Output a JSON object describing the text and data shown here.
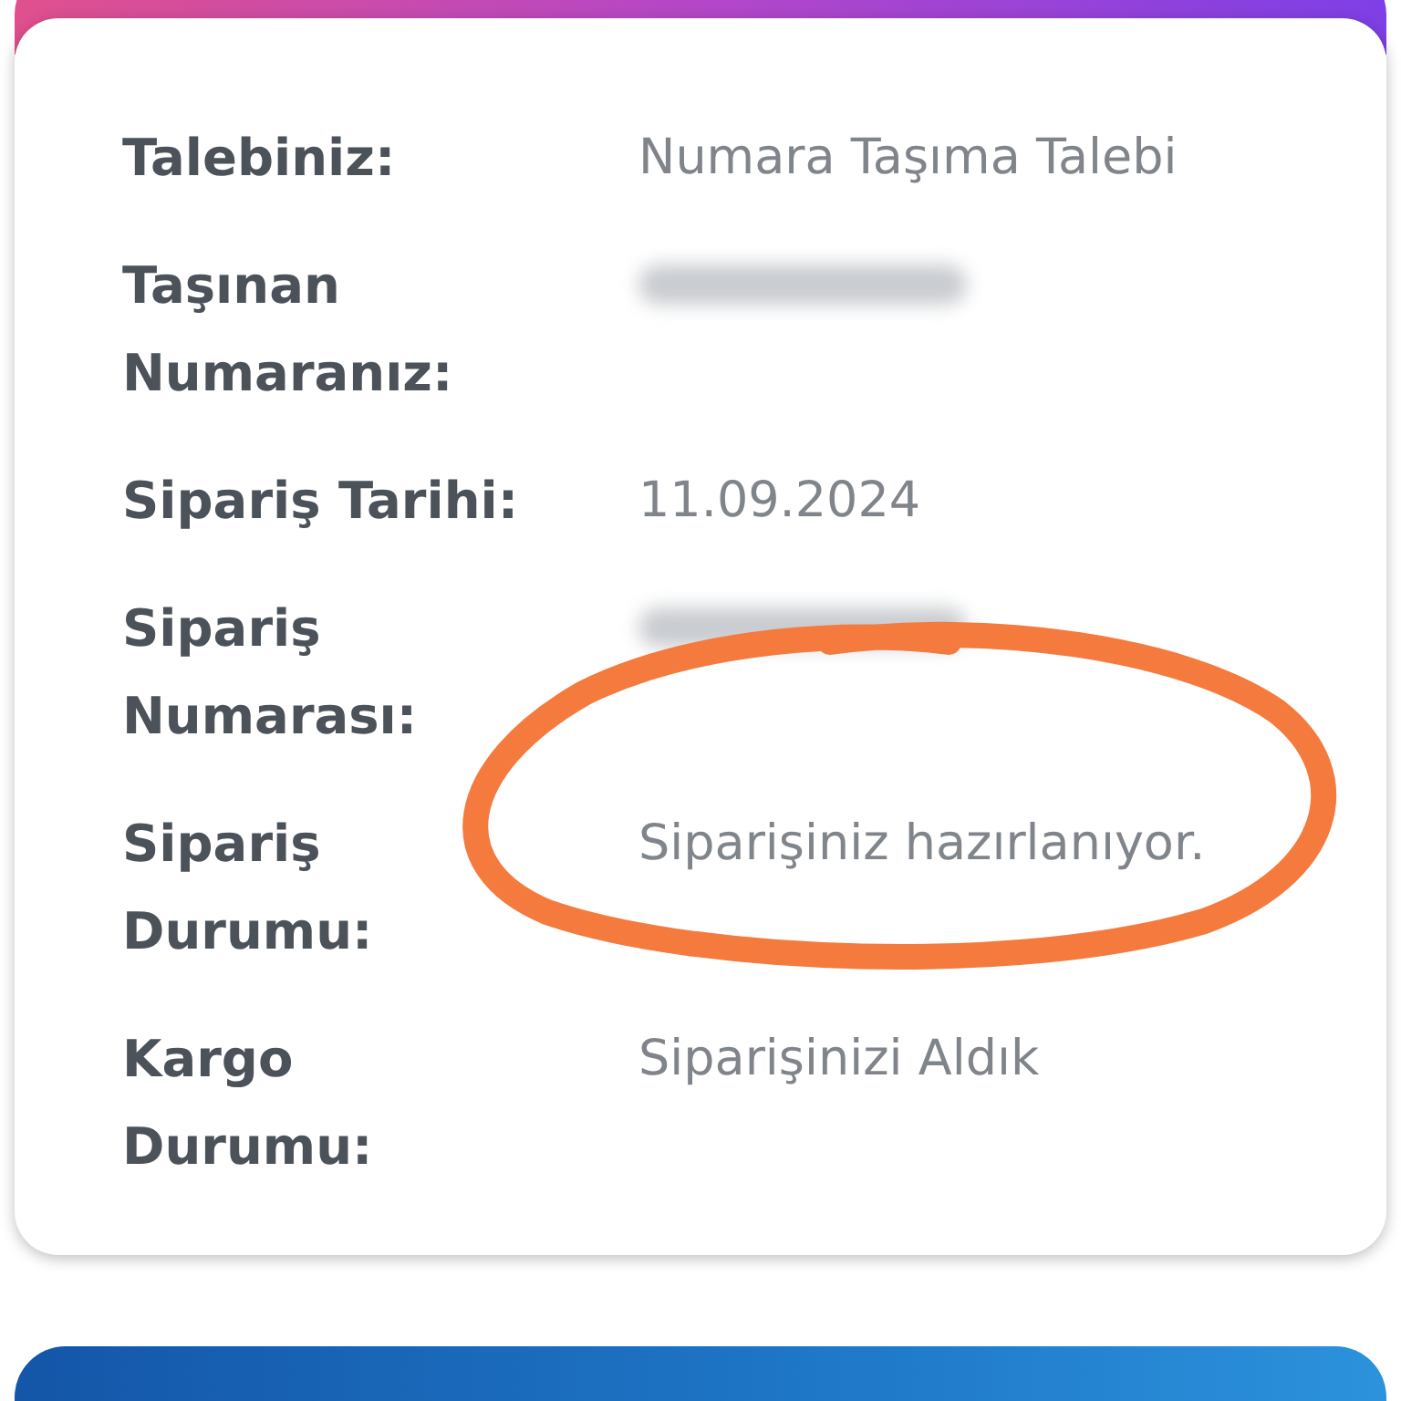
{
  "order_details": {
    "rows": [
      {
        "label": "Talebiniz:",
        "kind": "text",
        "value": "Numara Taşıma Talebi"
      },
      {
        "label": "Taşınan Numaranız:",
        "kind": "redacted"
      },
      {
        "label": "Sipariş Tarihi:",
        "kind": "text",
        "value": "11.09.2024"
      },
      {
        "label": "Sipariş Numarası:",
        "kind": "redacted"
      },
      {
        "label": "Sipariş Durumu:",
        "kind": "text",
        "value": "Siparişiniz hazırlanıyor."
      },
      {
        "label": "Kargo Durumu:",
        "kind": "text",
        "value": "Siparişinizi Aldık"
      }
    ]
  }
}
